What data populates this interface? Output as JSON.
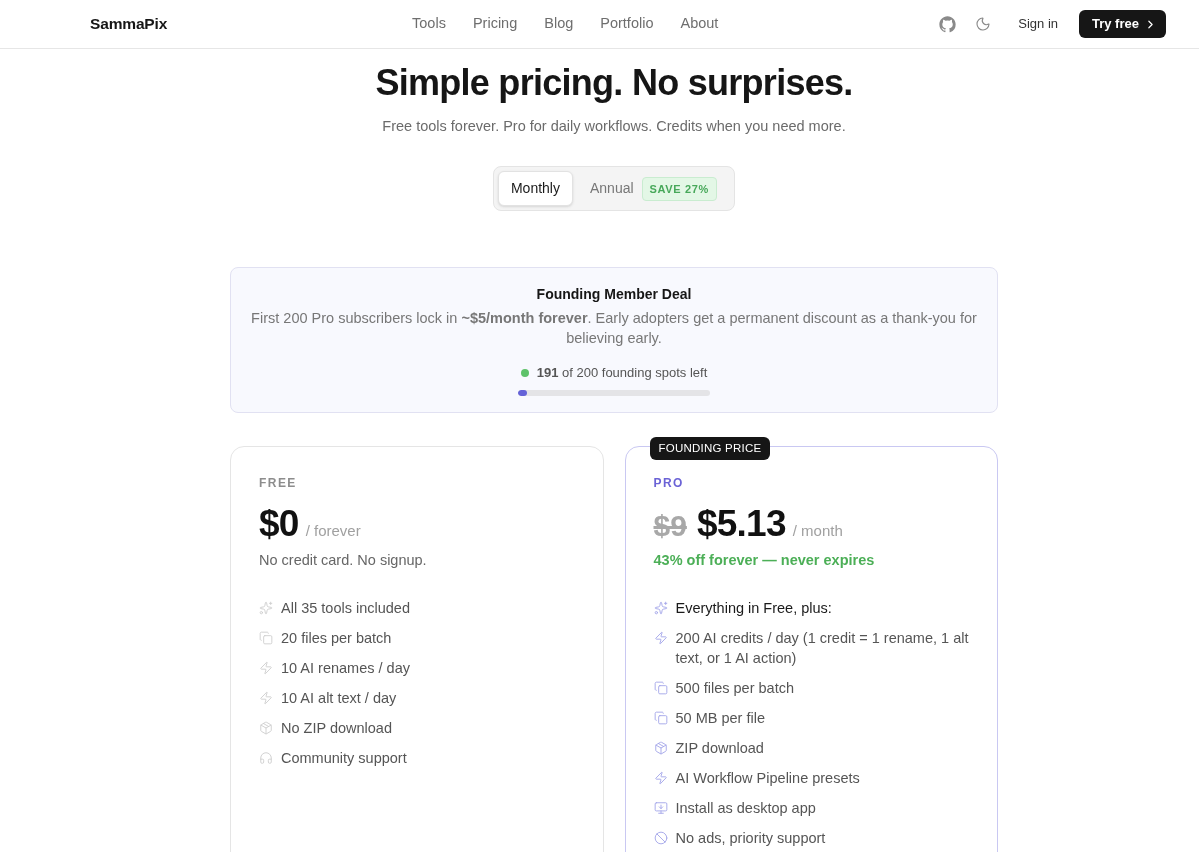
{
  "header": {
    "logo": "SammaPix",
    "nav": [
      "Tools",
      "Pricing",
      "Blog",
      "Portfolio",
      "About"
    ],
    "sign_in": "Sign in",
    "cta": "Try free"
  },
  "hero": {
    "title": "Simple pricing. No surprises.",
    "subtitle": "Free tools forever. Pro for daily workflows. Credits when you need more."
  },
  "billing_toggle": [
    {
      "label": "Monthly",
      "selected": true
    },
    {
      "label": "Annual",
      "selected": false,
      "badge": "SAVE 27%"
    }
  ],
  "founding_deal": {
    "title": "Founding Member Deal",
    "text": "First 200 Pro subscribers lock in **~$5/month forever**. Early adopters get a permanent discount as a thank-you for believing early.",
    "spots": "**191** of 200 founding spots left",
    "level": 0.045
  },
  "plans": [
    {
      "name": "FREE",
      "featured": false,
      "price": "$0",
      "period": "/ forever",
      "note": "No credit card. No signup.",
      "features": [
        {
          "kind": "tools",
          "text": "All 35 tools included",
          "emphasis": false
        },
        {
          "kind": "batch",
          "text": "20 files per batch",
          "emphasis": false
        },
        {
          "kind": "ai",
          "text": "10 AI renames / day",
          "emphasis": false
        },
        {
          "kind": "ai",
          "text": "10 AI alt text / day",
          "emphasis": false
        },
        {
          "kind": "download",
          "text": "No ZIP download",
          "emphasis": false
        },
        {
          "kind": "support",
          "text": "Community support",
          "emphasis": false
        }
      ]
    },
    {
      "name": "PRO",
      "featured": true,
      "badge": "FOUNDING PRICE",
      "original_price": "$9",
      "price": "$5.13",
      "period": "/ month",
      "note": "43% off forever — never expires",
      "features": [
        {
          "kind": "tools",
          "text": "Everything in Free, plus:",
          "emphasis": true
        },
        {
          "kind": "ai",
          "text": "200 AI credits / day (1 credit = 1 rename, 1 alt text, or 1 AI action)",
          "emphasis": false
        },
        {
          "kind": "batch",
          "text": "500 files per batch",
          "emphasis": false
        },
        {
          "kind": "batch",
          "text": "50 MB per file",
          "emphasis": false
        },
        {
          "kind": "download",
          "text": "ZIP download",
          "emphasis": false
        },
        {
          "kind": "ai",
          "text": "AI Workflow Pipeline presets",
          "emphasis": false
        },
        {
          "kind": "install",
          "text": "Install as desktop app",
          "emphasis": false
        },
        {
          "kind": "no_ads",
          "text": "No ads, priority support",
          "emphasis": false
        }
      ]
    }
  ]
}
